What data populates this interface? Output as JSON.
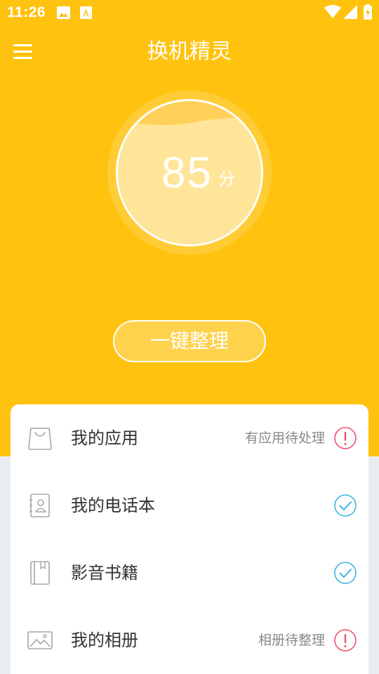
{
  "status_bar": {
    "time": "11:26",
    "notification_icons": [
      "image-icon",
      "font-icon"
    ],
    "system_icons": [
      "wifi-icon",
      "cellular-signal-icon",
      "battery-charging-icon"
    ]
  },
  "app_bar": {
    "title": "换机精灵",
    "menu_icon": "hamburger-menu-icon"
  },
  "score": {
    "value": "85",
    "unit": "分"
  },
  "action": {
    "cleanup_label": "一键整理"
  },
  "list": {
    "items": [
      {
        "label": "我的应用",
        "status": "有应用待处理",
        "icon": "shopping-bag-icon",
        "mark": "warning"
      },
      {
        "label": "我的电话本",
        "status": "",
        "icon": "contacts-book-icon",
        "mark": "check"
      },
      {
        "label": "影音书籍",
        "status": "",
        "icon": "book-icon",
        "mark": "check"
      },
      {
        "label": "我的相册",
        "status": "相册待整理",
        "icon": "photo-album-icon",
        "mark": "warning"
      }
    ]
  },
  "colors": {
    "brand_yellow": "#ffc20e",
    "warning_red": "#f0506e",
    "check_blue": "#3cb6e3",
    "background": "#e8edf0"
  }
}
